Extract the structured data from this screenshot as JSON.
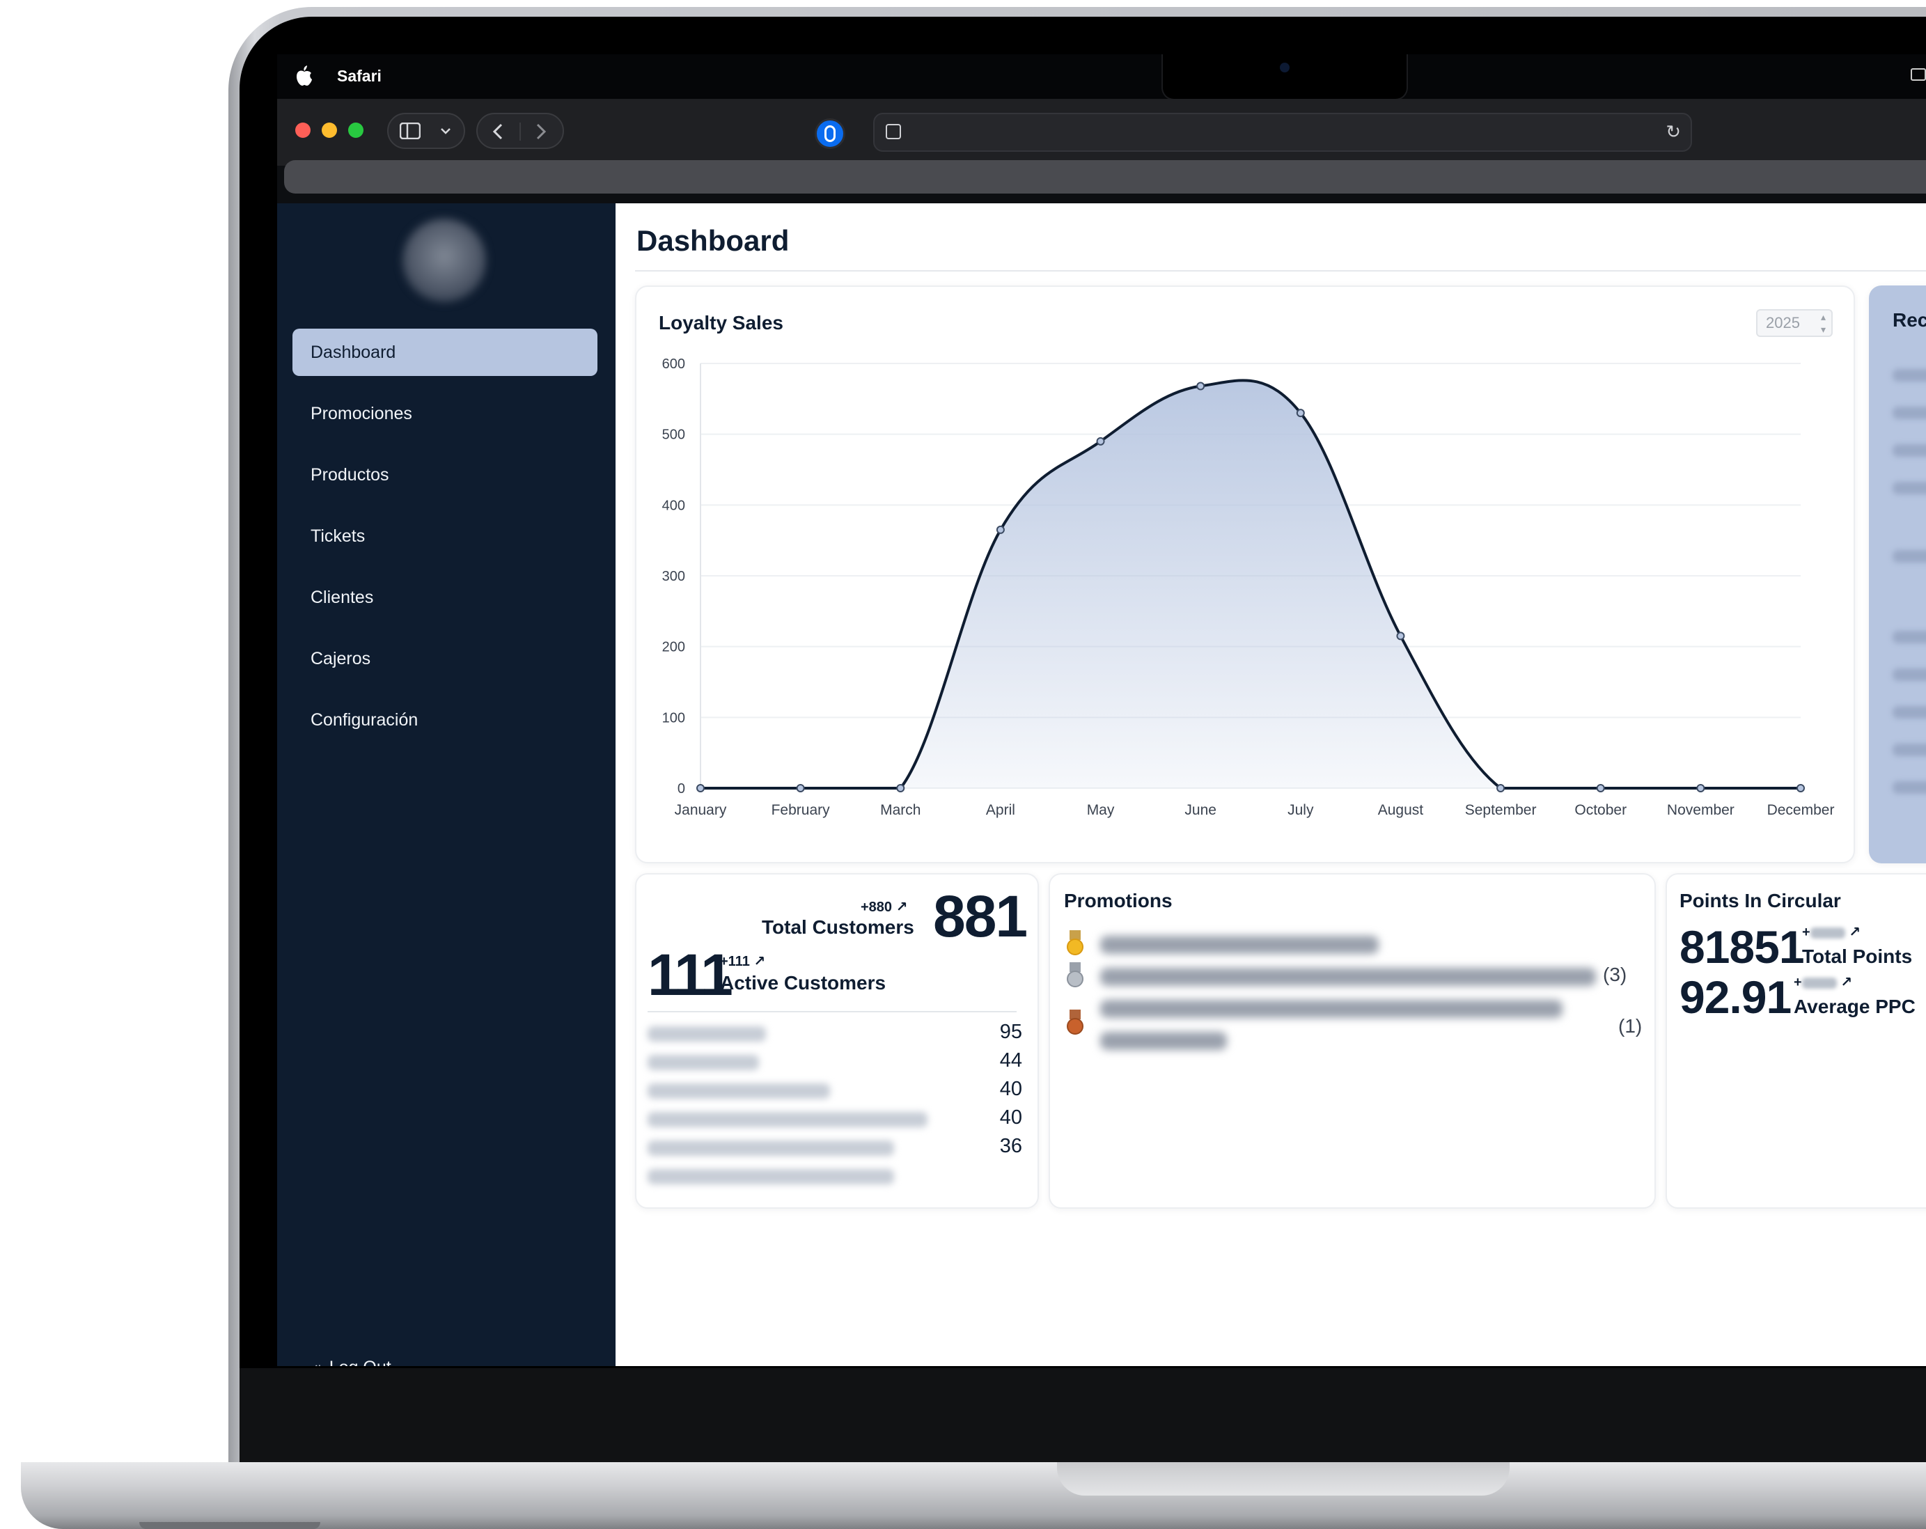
{
  "menubar": {
    "app_name": "Safari"
  },
  "page": {
    "title": "Dashboard"
  },
  "sidebar": {
    "items": [
      {
        "label": "Dashboard",
        "active": true
      },
      {
        "label": "Promociones"
      },
      {
        "label": "Productos"
      },
      {
        "label": "Tickets"
      },
      {
        "label": "Clientes"
      },
      {
        "label": "Cajeros"
      },
      {
        "label": "Configuración"
      }
    ],
    "logout_label": "Log Out"
  },
  "loyalty_sales": {
    "title": "Loyalty Sales",
    "year": "2025"
  },
  "chart_data": {
    "type": "area",
    "title": "Loyalty Sales",
    "categories": [
      "January",
      "February",
      "March",
      "April",
      "May",
      "June",
      "July",
      "August",
      "September",
      "October",
      "November",
      "December"
    ],
    "values": [
      0,
      0,
      0,
      365,
      490,
      568,
      530,
      215,
      0,
      0,
      0,
      0
    ],
    "ylim": [
      0,
      600
    ],
    "yticks": [
      "0",
      "100",
      "200",
      "300",
      "400",
      "500",
      "600"
    ],
    "grid": true,
    "fill_color": "#b6c5e0",
    "line_color": "#0f1d31"
  },
  "recent": {
    "title": "Rece"
  },
  "customers": {
    "total_delta": "+880",
    "total_label": "Total Customers",
    "total_value": "881",
    "active_value": "111",
    "active_delta": "+111",
    "active_label": "Active Customers",
    "top_scores": [
      "95",
      "44",
      "40",
      "40",
      "36"
    ]
  },
  "promotions": {
    "title": "Promotions",
    "counts": [
      "(3)",
      "(1)"
    ]
  },
  "points": {
    "title": "Points In Circular",
    "total_value": "81851",
    "total_label": "Total Points",
    "ppc_value": "92.91",
    "ppc_label": "Average PPC",
    "delta_prefix": "+"
  },
  "colors": {
    "sidebar_bg": "#0e1c2f",
    "accent": "#b6c5e0",
    "text_dark": "#0f1d31"
  }
}
